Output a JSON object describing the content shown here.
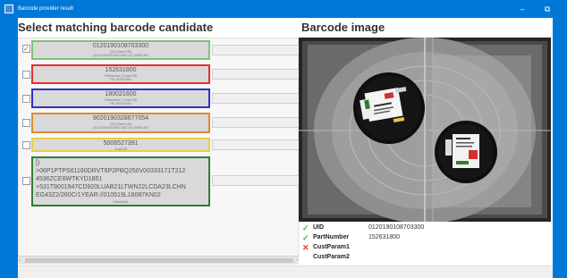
{
  "window": {
    "title": "Barcode provider result",
    "minimize_glyph": "–",
    "close_glyph": "⧉"
  },
  "left_panel": {
    "heading": "Select matching barcode candidate",
    "candidates": [
      {
        "value": "0120190108703300",
        "sub1": "(31) Gtwiet (35)",
        "sub2": "(31) 0120190108703300 (31) 46891300",
        "border_color": "#7cc47c",
        "checked": true
      },
      {
        "value": "152631800",
        "sub1": "Partnumber (Code128)",
        "sub2": "PN 152631800",
        "border_color": "#e03030",
        "checked": false
      },
      {
        "value": "180021600",
        "sub1": "Partnumber (Code128)",
        "sub2": "PN 180021600",
        "border_color": "#3030d0",
        "checked": false
      },
      {
        "value": "9020190328677054",
        "sub1": "(31) Gtwiet (35)",
        "sub2": "(31) 9020190328677054 (31) 46891300",
        "border_color": "#e08a30",
        "checked": false
      },
      {
        "value": "5006527391",
        "sub1": "Code128",
        "sub2": "",
        "border_color": "#e8d040",
        "checked": false
      },
      {
        "value": "[)\n>06P1PTPS61160DRVT6P2PBQ250V00333171T212\n4536ZCE6WTKYD1851\n+531T9001947CD920LUAB21LTWN22LCDA23LCHN\nEG43Z2/260C/1YEAR://010519L16087KN02",
        "sub1": "DataMatrix",
        "sub2": "",
        "border_color": "#2e7d32",
        "checked": false
      }
    ],
    "dropdown_arrow": "⌄"
  },
  "right_panel": {
    "heading": "Barcode image",
    "params": [
      {
        "name": "UID",
        "value": "0120190108703300",
        "status": "ok",
        "mark": "✓"
      },
      {
        "name": "PartNumber",
        "value": "152631800",
        "status": "ok",
        "mark": "✓"
      },
      {
        "name": "CustParam1",
        "value": "",
        "status": "bad",
        "mark": "✕"
      },
      {
        "name": "CustParam2",
        "value": "",
        "status": "none",
        "mark": ""
      }
    ]
  },
  "scrollbar": {
    "left_arrow": "‹",
    "right_arrow": "›"
  }
}
